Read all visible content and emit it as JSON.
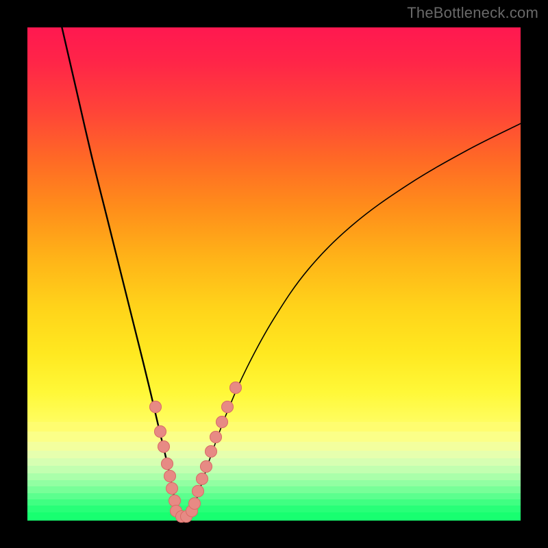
{
  "watermark": "TheBottleneck.com",
  "chart_data": {
    "type": "line",
    "title": "",
    "xlabel": "",
    "ylabel": "",
    "xlim": [
      0,
      100
    ],
    "ylim": [
      0,
      100
    ],
    "grid": false,
    "series": [
      {
        "name": "left-curve",
        "x": [
          7,
          10,
          13,
          16,
          19,
          21.5,
          23.5,
          25.2,
          26.6,
          27.8,
          28.7,
          29.3,
          29.8,
          30.2,
          30.7
        ],
        "y": [
          100,
          87,
          74,
          62,
          50,
          40,
          32,
          25,
          19,
          14,
          10,
          7,
          4.5,
          2.5,
          0.8
        ],
        "color": "#000000"
      },
      {
        "name": "right-curve",
        "x": [
          33.0,
          34.0,
          35.5,
          37.5,
          40.5,
          44.5,
          50,
          57,
          66,
          77,
          89,
          100
        ],
        "y": [
          0.8,
          3.5,
          8,
          14,
          22,
          31,
          41,
          51,
          60,
          68,
          75,
          80.5
        ],
        "color": "#000000"
      },
      {
        "name": "flat-bottom",
        "x": [
          30.7,
          33.0
        ],
        "y": [
          0.8,
          0.8
        ],
        "color": "#000000"
      }
    ],
    "datapoints": [
      {
        "series": "left-curve",
        "x": 26.0,
        "y": 23.0
      },
      {
        "series": "left-curve",
        "x": 27.0,
        "y": 18.0
      },
      {
        "series": "left-curve",
        "x": 27.6,
        "y": 15.0
      },
      {
        "series": "left-curve",
        "x": 28.3,
        "y": 11.5
      },
      {
        "series": "left-curve",
        "x": 28.9,
        "y": 9.0
      },
      {
        "series": "left-curve",
        "x": 29.3,
        "y": 6.5
      },
      {
        "series": "left-curve",
        "x": 29.8,
        "y": 4.0
      },
      {
        "series": "left-curve",
        "x": 30.2,
        "y": 2.0
      },
      {
        "series": "flat-bottom",
        "x": 31.2,
        "y": 0.8
      },
      {
        "series": "flat-bottom",
        "x": 32.2,
        "y": 0.8
      },
      {
        "series": "right-curve",
        "x": 33.4,
        "y": 2.0
      },
      {
        "series": "right-curve",
        "x": 33.9,
        "y": 3.5
      },
      {
        "series": "right-curve",
        "x": 34.6,
        "y": 6.0
      },
      {
        "series": "right-curve",
        "x": 35.4,
        "y": 8.5
      },
      {
        "series": "right-curve",
        "x": 36.2,
        "y": 11.0
      },
      {
        "series": "right-curve",
        "x": 37.2,
        "y": 14.0
      },
      {
        "series": "right-curve",
        "x": 38.2,
        "y": 17.0
      },
      {
        "series": "right-curve",
        "x": 39.4,
        "y": 20.0
      },
      {
        "series": "right-curve",
        "x": 40.6,
        "y": 23.0
      },
      {
        "series": "right-curve",
        "x": 42.2,
        "y": 27.0
      }
    ],
    "datapoint_style": {
      "fill": "#e78a84",
      "stroke": "#d86c66",
      "radius_px": 9
    },
    "gradient_stops": [
      {
        "pct": 0,
        "color": "#ff1850"
      },
      {
        "pct": 17,
        "color": "#ff4438"
      },
      {
        "pct": 37,
        "color": "#ff8f1a"
      },
      {
        "pct": 57,
        "color": "#ffd41a"
      },
      {
        "pct": 74,
        "color": "#fff838"
      },
      {
        "pct": 89,
        "color": "#e6ffae"
      },
      {
        "pct": 100,
        "color": "#18ff70"
      }
    ],
    "bottom_bands": [
      {
        "top_pct": 80.0,
        "height_pct": 2.0,
        "color": "#fffd70"
      },
      {
        "top_pct": 82.0,
        "height_pct": 2.0,
        "color": "#fbff88"
      },
      {
        "top_pct": 84.0,
        "height_pct": 1.8,
        "color": "#f3ff9e"
      },
      {
        "top_pct": 85.8,
        "height_pct": 1.6,
        "color": "#e6ffae"
      },
      {
        "top_pct": 87.4,
        "height_pct": 1.5,
        "color": "#d6ffb2"
      },
      {
        "top_pct": 88.9,
        "height_pct": 1.5,
        "color": "#c2ffb0"
      },
      {
        "top_pct": 90.4,
        "height_pct": 1.4,
        "color": "#aaffaa"
      },
      {
        "top_pct": 91.8,
        "height_pct": 1.3,
        "color": "#92ffa2"
      },
      {
        "top_pct": 93.1,
        "height_pct": 1.3,
        "color": "#78ff98"
      },
      {
        "top_pct": 94.4,
        "height_pct": 1.3,
        "color": "#5cff8e"
      },
      {
        "top_pct": 95.7,
        "height_pct": 1.3,
        "color": "#40ff82"
      },
      {
        "top_pct": 97.0,
        "height_pct": 1.4,
        "color": "#28ff78"
      },
      {
        "top_pct": 98.4,
        "height_pct": 1.6,
        "color": "#18ff70"
      }
    ]
  }
}
